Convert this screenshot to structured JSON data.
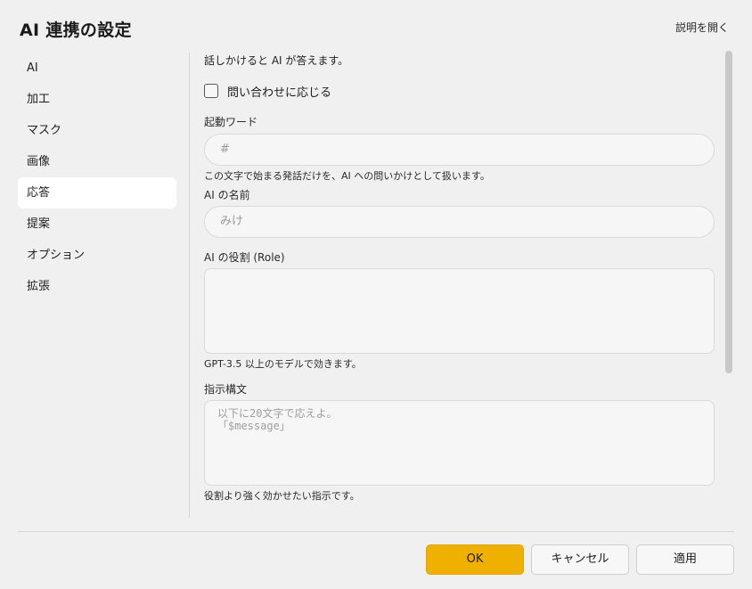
{
  "dialog": {
    "title": "AI 連携の設定",
    "help_link": "説明を開く"
  },
  "sidebar": {
    "items": [
      {
        "label": "AI"
      },
      {
        "label": "加工"
      },
      {
        "label": "マスク"
      },
      {
        "label": "画像"
      },
      {
        "label": "応答",
        "active": true
      },
      {
        "label": "提案"
      },
      {
        "label": "オプション"
      },
      {
        "label": "拡張"
      }
    ]
  },
  "content": {
    "description": "話しかけると AI が答えます。",
    "respond_checkbox": {
      "label": "問い合わせに応じる",
      "checked": false
    },
    "trigger_word": {
      "label": "起動ワード",
      "placeholder": "#",
      "help": "この文字で始まる発話だけを、AI への問いかけとして扱います。"
    },
    "ai_name": {
      "label": "AI の名前",
      "placeholder": "みけ"
    },
    "ai_role": {
      "label": "AI の役割 (Role)",
      "value": "",
      "help": "GPT-3.5 以上のモデルで効きます。"
    },
    "instruction": {
      "label": "指示構文",
      "placeholder_lines": [
        "以下に20文字で応えよ。",
        "「$message」"
      ],
      "help": "役割より強く効かせたい指示です。"
    }
  },
  "footer": {
    "ok_label": "OK",
    "cancel_label": "キャンセル",
    "apply_label": "適用"
  },
  "colors": {
    "background": "#f0f0f0",
    "accent": "#f0b000",
    "active_nav": "#ffffff"
  }
}
